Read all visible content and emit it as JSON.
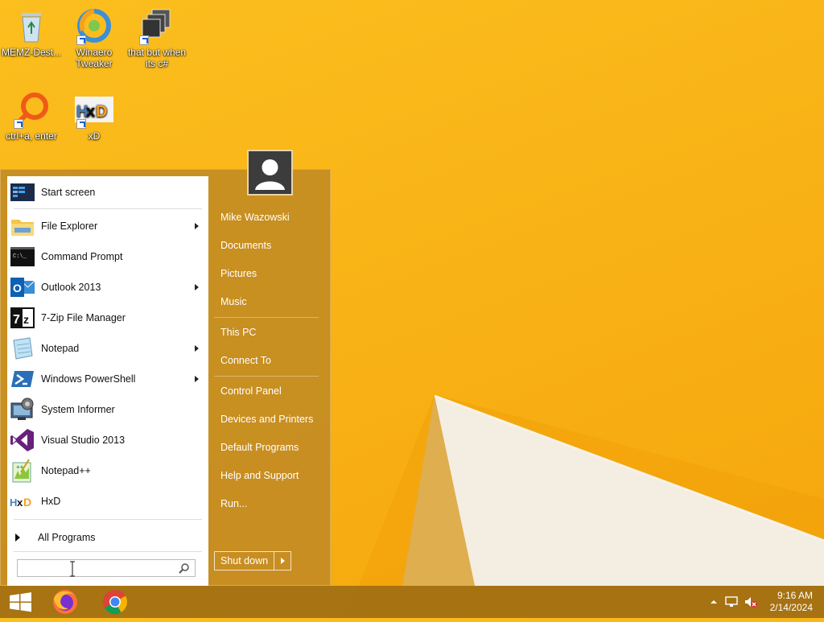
{
  "desktop": {
    "icons": [
      {
        "label": "MEMZ-Dest..."
      },
      {
        "label": "Winaero Tweaker"
      },
      {
        "label": "that but when its c#"
      },
      {
        "label": "ctrl+a, enter"
      },
      {
        "label": "xD"
      }
    ]
  },
  "start_menu": {
    "programs": [
      {
        "label": "Start screen",
        "icon": "start-screen-icon"
      },
      {
        "label": "File Explorer",
        "icon": "folder-icon"
      },
      {
        "label": "Command Prompt",
        "icon": "terminal-icon"
      },
      {
        "label": "Outlook 2013",
        "icon": "outlook-icon"
      },
      {
        "label": "7-Zip File Manager",
        "icon": "7zip-icon"
      },
      {
        "label": "Notepad",
        "icon": "notepad-icon"
      },
      {
        "label": "Windows PowerShell",
        "icon": "powershell-icon"
      },
      {
        "label": "System Informer",
        "icon": "system-informer-icon"
      },
      {
        "label": "Visual Studio 2013",
        "icon": "visual-studio-icon"
      },
      {
        "label": "Notepad++",
        "icon": "notepad-plus-icon"
      },
      {
        "label": "HxD",
        "icon": "hxd-icon"
      }
    ],
    "all_programs": "All Programs",
    "search": {
      "value": "",
      "placeholder": ""
    },
    "right": {
      "user": "Mike Wazowski",
      "documents": "Documents",
      "pictures": "Pictures",
      "music": "Music",
      "this_pc": "This PC",
      "connect_to": "Connect To",
      "control_panel": "Control Panel",
      "devices_printers": "Devices and Printers",
      "default_programs": "Default Programs",
      "help_support": "Help and Support",
      "run": "Run..."
    },
    "shutdown": "Shut down"
  },
  "taskbar": {
    "apps": [
      "firefox-icon",
      "chrome-icon"
    ],
    "clock": {
      "time": "9:16 AM",
      "date": "2/14/2024"
    }
  },
  "colors": {
    "wallpaper": "#f9b316",
    "menu_frame": "#c48c22",
    "taskbar": "#a06e14"
  }
}
